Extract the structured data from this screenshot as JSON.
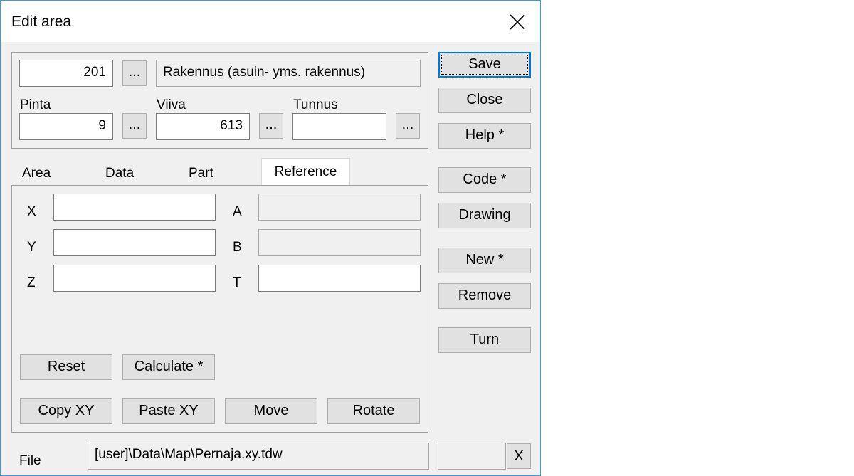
{
  "window": {
    "title": "Edit area"
  },
  "top": {
    "code_value": "201",
    "browse_label": "...",
    "code_description": "Rakennus (asuin- yms. rakennus)",
    "pinta_label": "Pinta",
    "pinta_value": "9",
    "viiva_label": "Viiva",
    "viiva_value": "613",
    "tunnus_label": "Tunnus",
    "tunnus_value": ""
  },
  "tabs": [
    "Area",
    "Data",
    "Part",
    "Reference"
  ],
  "active_tab": "Reference",
  "reference": {
    "x_label": "X",
    "y_label": "Y",
    "z_label": "Z",
    "a_label": "A",
    "b_label": "B",
    "t_label": "T",
    "x_value": "",
    "y_value": "",
    "z_value": "",
    "a_value": "",
    "b_value": "",
    "t_value": "",
    "reset_label": "Reset",
    "calculate_label": "Calculate *",
    "copy_xy_label": "Copy XY",
    "paste_xy_label": "Paste XY",
    "move_label": "Move",
    "rotate_label": "Rotate"
  },
  "side_buttons": {
    "save": "Save",
    "close": "Close",
    "help": "Help *",
    "code": "Code *",
    "drawing": "Drawing",
    "new": "New *",
    "remove": "Remove",
    "turn": "Turn"
  },
  "file": {
    "label": "File",
    "path": "[user]\\Data\\Map\\Pernaja.xy.tdw",
    "extra_value": "",
    "clear_label": "X"
  },
  "colors": {
    "accent": "#0078d7",
    "border": "#3c99d8",
    "dialog_bg": "#f0f0f0"
  }
}
